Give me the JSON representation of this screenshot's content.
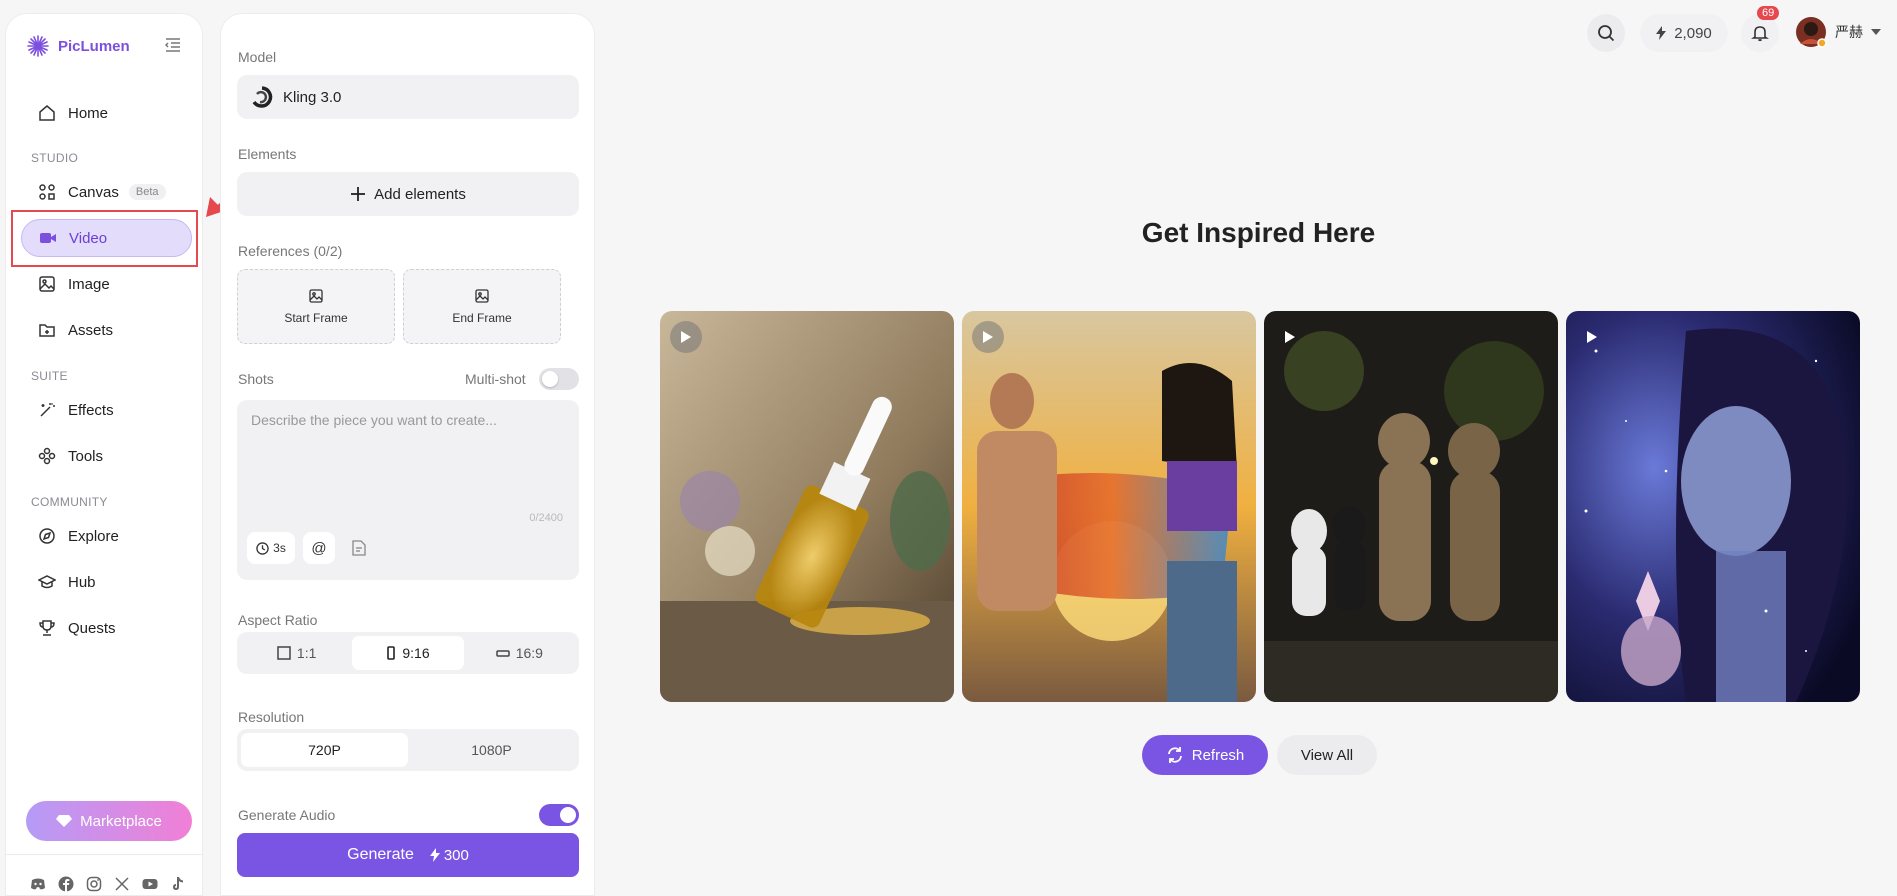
{
  "app": {
    "name": "PicLumen"
  },
  "sidebar": {
    "home": "Home",
    "studio_label": "STUDIO",
    "canvas": "Canvas",
    "canvas_badge": "Beta",
    "video": "Video",
    "image": "Image",
    "assets": "Assets",
    "suite_label": "SUITE",
    "effects": "Effects",
    "tools": "Tools",
    "community_label": "COMMUNITY",
    "explore": "Explore",
    "hub": "Hub",
    "quests": "Quests",
    "marketplace": "Marketplace",
    "social_icons": [
      "discord-icon",
      "facebook-icon",
      "instagram-icon",
      "x-icon",
      "youtube-icon",
      "tiktok-icon"
    ]
  },
  "panel": {
    "model_label": "Model",
    "model_value": "Kling 3.0",
    "elements_label": "Elements",
    "add_elements": "Add elements",
    "references_label": "References (0/2)",
    "start_frame": "Start Frame",
    "end_frame": "End Frame",
    "shots_label": "Shots",
    "multishot_label": "Multi-shot",
    "multishot_on": false,
    "prompt_placeholder": "Describe the piece you want to create...",
    "prompt_count": "0/2400",
    "duration": "3s",
    "aspect_label": "Aspect Ratio",
    "aspect_options": [
      "1:1",
      "9:16",
      "16:9"
    ],
    "aspect_selected": "9:16",
    "resolution_label": "Resolution",
    "resolution_options": [
      "720P",
      "1080P"
    ],
    "resolution_selected": "720P",
    "audio_label": "Generate Audio",
    "audio_on": true,
    "generate_label": "Generate",
    "generate_cost": "300"
  },
  "topbar": {
    "credits": "2,090",
    "notifications": "69",
    "username": "严赫"
  },
  "main": {
    "title": "Get Inspired Here",
    "refresh": "Refresh",
    "view_all": "View All"
  },
  "colors": {
    "accent": "#7a55e3",
    "highlight": "#e5484d",
    "active_bg": "#e4dcfb"
  }
}
